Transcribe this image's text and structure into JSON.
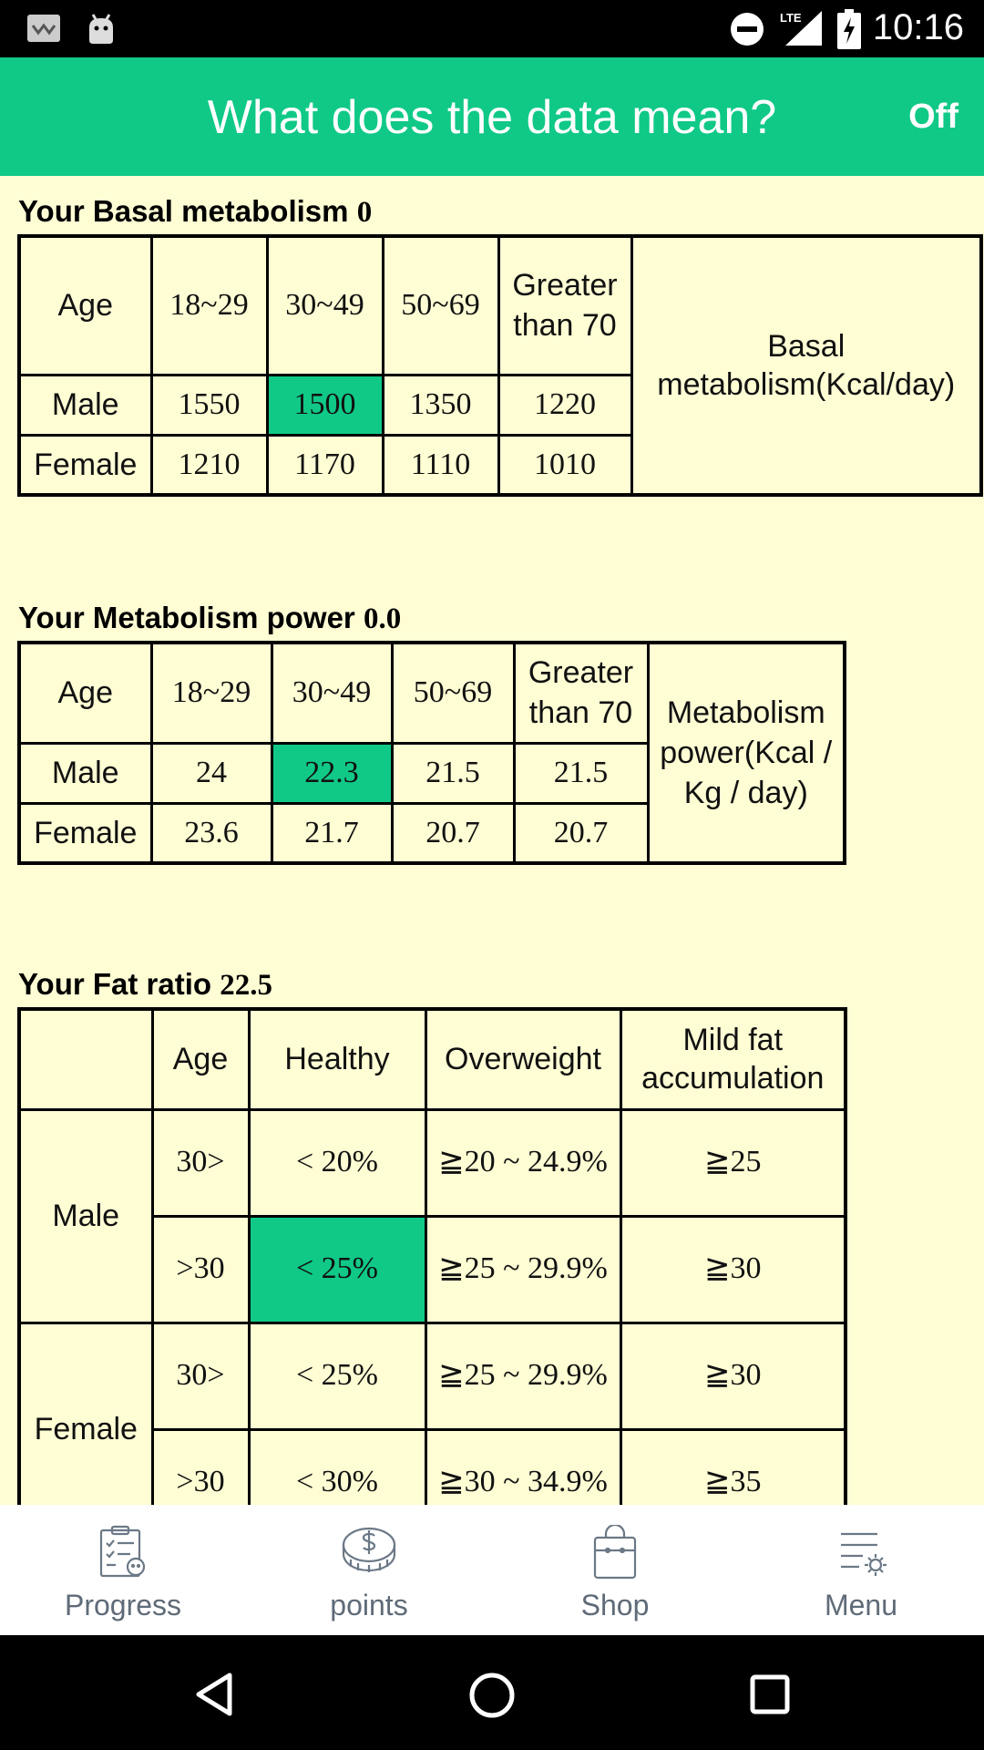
{
  "status_bar": {
    "time": "10:16",
    "icons": [
      "app-notification-icon",
      "android-icon",
      "dnd-icon",
      "lte-signal-icon",
      "battery-charging-icon"
    ]
  },
  "app_bar": {
    "title": "What does the data mean?",
    "toggle_label": "Off"
  },
  "basal": {
    "title": "Your Basal metabolism",
    "value": "0",
    "headers": [
      "Age",
      "18~29",
      "30~49",
      "50~69",
      "Greater than 70"
    ],
    "rows": [
      {
        "label": "Male",
        "values": [
          "1550",
          "1500",
          "1350",
          "1220"
        ]
      },
      {
        "label": "Female",
        "values": [
          "1210",
          "1170",
          "1110",
          "1010"
        ]
      }
    ],
    "unit": "Basal metabolism(Kcal/day)",
    "highlight": {
      "row": "Male",
      "column": "30~49"
    }
  },
  "power": {
    "title": "Your Metabolism power",
    "value": "0.0",
    "headers": [
      "Age",
      "18~29",
      "30~49",
      "50~69",
      "Greater than 70"
    ],
    "rows": [
      {
        "label": "Male",
        "values": [
          "24",
          "22.3",
          "21.5",
          "21.5"
        ]
      },
      {
        "label": "Female",
        "values": [
          "23.6",
          "21.7",
          "20.7",
          "20.7"
        ]
      }
    ],
    "unit": "Metabolism power(Kcal / Kg / day)",
    "highlight": {
      "row": "Male",
      "column": "30~49"
    }
  },
  "fat": {
    "title": "Your Fat ratio",
    "value": "22.5",
    "headers": [
      "",
      "Age",
      "Healthy",
      "Overweight",
      "Mild fat accumulation"
    ],
    "groups": [
      {
        "label": "Male",
        "rows": [
          {
            "age": "30>",
            "healthy": "< 20%",
            "overweight": "≧20 ~ 24.9%",
            "mild": "≧25"
          },
          {
            "age": ">30",
            "healthy": "< 25%",
            "overweight": "≧25 ~ 29.9%",
            "mild": "≧30"
          }
        ]
      },
      {
        "label": "Female",
        "rows": [
          {
            "age": "30>",
            "healthy": "< 25%",
            "overweight": "≧25 ~ 29.9%",
            "mild": "≧30"
          },
          {
            "age": ">30",
            "healthy": "< 30%",
            "overweight": "≧30 ~ 34.9%",
            "mild": "≧35"
          }
        ]
      }
    ],
    "highlight": {
      "group": "Male",
      "age": ">30",
      "column": "Healthy"
    }
  },
  "bottom_nav": [
    {
      "label": "Progress",
      "icon": "clipboard-progress-icon"
    },
    {
      "label": "points",
      "icon": "dollar-coin-icon"
    },
    {
      "label": "Shop",
      "icon": "shopping-bag-icon"
    },
    {
      "label": "Menu",
      "icon": "menu-settings-icon"
    }
  ],
  "colors": {
    "accent": "#10c987",
    "background": "#fffdd4",
    "nav_label": "#5f6b78"
  }
}
